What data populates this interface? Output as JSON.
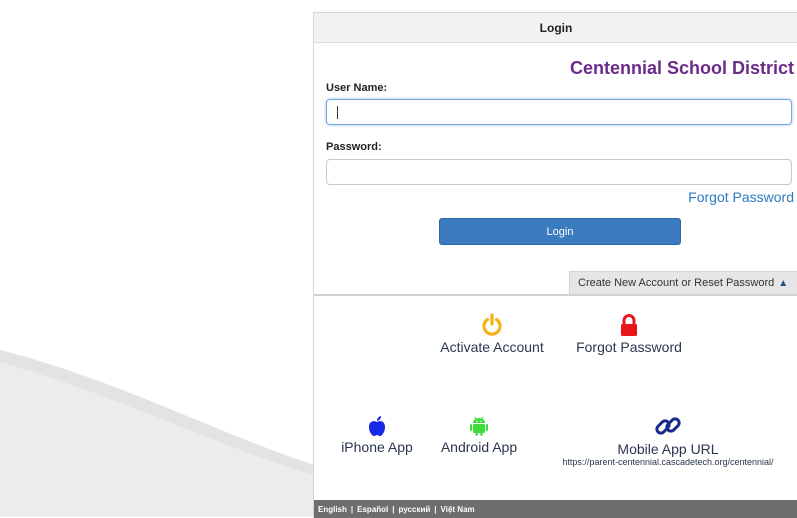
{
  "panel": {
    "header_title": "Login",
    "district_name": "Centennial School District"
  },
  "form": {
    "username_label": "User Name:",
    "username_value": "",
    "password_label": "Password:",
    "password_value": "",
    "forgot_password_link": "Forgot Password",
    "login_button": "Login"
  },
  "reset_toggle": {
    "label": "Create New Account or Reset Password"
  },
  "tiles": {
    "activate": {
      "label": "Activate Account",
      "icon": "power-icon",
      "color": "#f2b21b"
    },
    "forgot": {
      "label": "Forgot Password",
      "icon": "lock-icon",
      "color": "#e8151b"
    },
    "iphone": {
      "label": "iPhone App",
      "icon": "apple-icon",
      "color": "#1428e6"
    },
    "android": {
      "label": "Android App",
      "icon": "android-icon",
      "color": "#3ddc3a"
    },
    "mobile_url": {
      "label": "Mobile App URL",
      "icon": "link-icon",
      "color": "#1a2a8a",
      "url": "https://parent-centennial.cascadetech.org/centennial/"
    }
  },
  "footer": {
    "languages": [
      "English",
      "Español",
      "русский",
      "Việt Nam"
    ]
  }
}
